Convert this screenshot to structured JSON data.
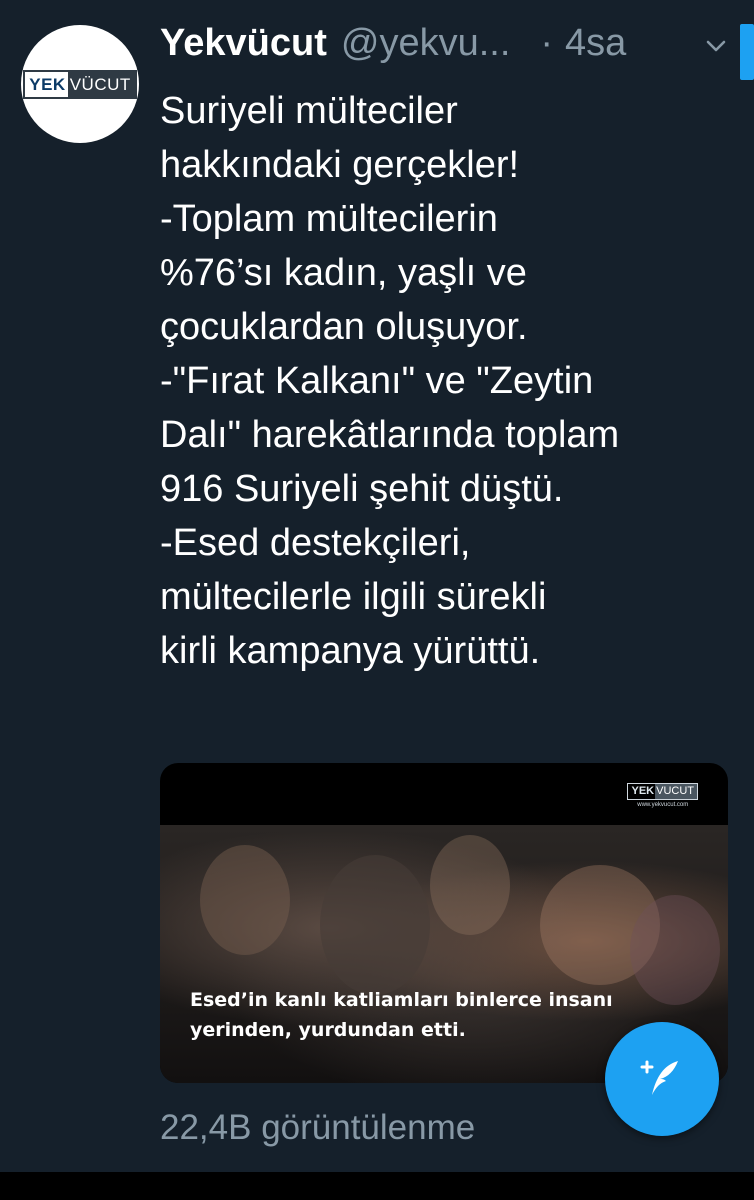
{
  "tweet": {
    "author_name": "Yekvücut",
    "author_handle": "@yekvu...",
    "separator": "·",
    "timestamp": "4sa",
    "avatar_logo": {
      "part1": "YEK",
      "part2": "VÜCUT"
    },
    "text_lines": [
      "Suriyeli mülteciler",
      "hakkındaki gerçekler!",
      "-Toplam mültecilerin",
      "%76’sı kadın, yaşlı ve",
      "çocuklardan oluşuyor.",
      "-\"Fırat Kalkanı\" ve \"Zeytin",
      "Dalı\" harekâtlarında toplam",
      "916 Suriyeli şehit düştü.",
      "-Esed destekçileri,",
      "mültecilerle ilgili sürekli",
      "kirli kampanya yürüttü."
    ],
    "media": {
      "watermark": {
        "part1": "YEK",
        "part2": "VUCUT",
        "url": "www.yekvucut.com"
      },
      "subtitle_lines": [
        "Esed’in kanlı katliamları binlerce insanı",
        "yerinden, yurdundan etti."
      ]
    },
    "views": "22,4B görüntülenme"
  },
  "icons": {
    "chevron": "chevron-down-icon",
    "compose": "compose-tweet-icon"
  },
  "colors": {
    "background": "#15202b",
    "accent": "#1da1f2",
    "secondary_text": "#8899a6"
  }
}
